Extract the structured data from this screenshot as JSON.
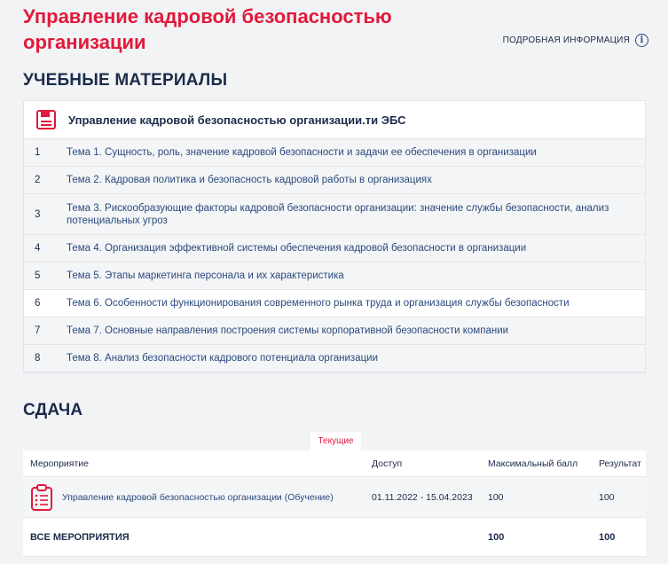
{
  "course": {
    "title": "Управление кадровой безопасностью организации",
    "more_info": "ПОДРОБНАЯ ИНФОРМАЦИЯ"
  },
  "materials": {
    "heading": "УЧЕБНЫЕ МАТЕРИАЛЫ",
    "resource_name": "Управление кадровой безопасностью организации.ти ЭБС",
    "topics": [
      {
        "num": "1",
        "label": "Тема 1. Сущность, роль, значение кадровой безопасности и задачи ее обеспечения в организации"
      },
      {
        "num": "2",
        "label": "Тема 2. Кадровая политика и безопасность кадровой работы в организациях"
      },
      {
        "num": "3",
        "label": "Тема 3. Рискообразующие факторы кадровой безопасности организации: значение службы безопасности, анализ потенциальных угроз"
      },
      {
        "num": "4",
        "label": "Тема 4. Организация эффективной системы обеспечения кадровой безопасности в организации"
      },
      {
        "num": "5",
        "label": "Тема 5. Этапы маркетинга персонала и их характеристика"
      },
      {
        "num": "6",
        "label": "Тема 6. Особенности функционирования современного рынка труда и организация службы безопасности"
      },
      {
        "num": "7",
        "label": "Тема 7. Основные направления построения системы корпоративной безопасности компании"
      },
      {
        "num": "8",
        "label": "Тема 8. Анализ безопасности кадрового потенциала организации"
      }
    ]
  },
  "submission": {
    "heading": "СДАЧА",
    "tab_current": "Текущие",
    "columns": {
      "event": "Мероприятие",
      "access": "Доступ",
      "max_score": "Максимальный балл",
      "result": "Результат"
    },
    "rows": [
      {
        "event": "Управление кадровой безопасностью организации (Обучение)",
        "access": "01.11.2022 - 15.04.2023",
        "max_score": "100",
        "result": "100"
      }
    ],
    "total": {
      "label": "ВСЕ МЕРОПРИЯТИЯ",
      "max_score": "100",
      "result": "100"
    }
  },
  "colors": {
    "accent": "#e1193b",
    "text": "#1c2b4a",
    "link": "#2a4a7c"
  }
}
